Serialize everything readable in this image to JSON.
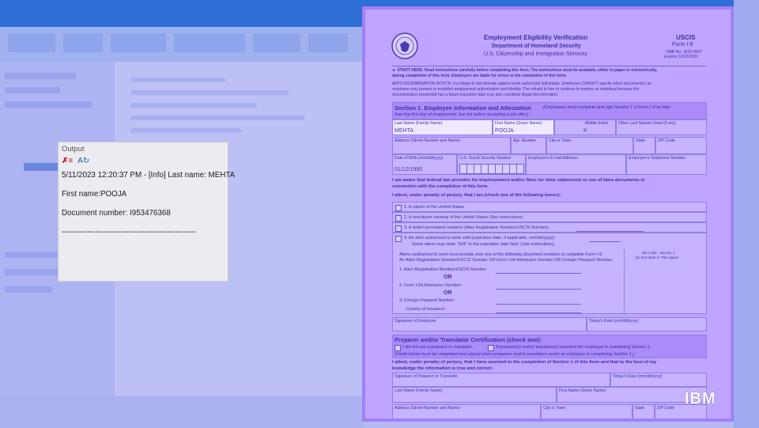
{
  "output_panel": {
    "title": "Output",
    "icons": [
      "clear-output-icon",
      "word-wrap-icon"
    ],
    "lines": [
      "5/11/2023 12:20:37 PM - [Info] Last name: MEHTA",
      "First name:POOJA",
      "Document number: I953476368",
      "----------------------------------------------------"
    ]
  },
  "form": {
    "title": "Employment Eligibility Verification",
    "department": "Department of Homeland Security",
    "agency": "U.S. Citizenship and Immigration Services",
    "uscis": "USCIS",
    "form_no": "Form I-9",
    "omb": "OMB No. 1615-0047",
    "expires": "Expires 10/31/2022",
    "start_here_1": "► START HERE: Read instructions carefully before completing this form. The instructions must be available, either in paper or electronically,",
    "start_here_2": "during completion of this form. Employers are liable for errors in the completion of this form.",
    "anti_1": "ANTI-DISCRIMINATION NOTICE: It is illegal to discriminate against work-authorized individuals. Employers CANNOT specify which document(s) an",
    "anti_2": "employee may present to establish employment authorization and identity. The refusal to hire or continue to employ an individual because the",
    "anti_3": "documentation presented has a future expiration date may also constitute illegal discrimination.",
    "section1_title": "Section 1. Employee Information and Attestation",
    "section1_sub_1": "(Employees must complete and sign Section 1 of Form I-9 no later",
    "section1_sub_2": "than the first day of employment, but not before accepting a job offer.)",
    "last_name_label": "Last Name (Family Name)",
    "last_name_value": "MEHTA",
    "first_name_label": "First Name (Given Name)",
    "first_name_value": "POOJA",
    "middle_initial_label": "Middle Initial",
    "middle_initial_value": "K",
    "other_last_names_label": "Other Last Names Used (if any)",
    "address_label": "Address (Street Number and Name)",
    "apt_label": "Apt. Number",
    "city_label": "City or Town",
    "state_label": "State",
    "zip_label": "ZIP Code",
    "dob_label": "Date of Birth (mm/dd/yyyy)",
    "dob_value": "01/12/1990",
    "ssn_label": "U.S. Social Security Number",
    "email_label": "Employee's E-mail Address",
    "phone_label": "Employee's Telephone Number",
    "aware_1": "I am aware that federal law provides for imprisonment and/or fines for false statements or use of false documents in",
    "aware_2": "connection with the completion of this form.",
    "attest": "I attest, under penalty of perjury, that I am (check one of the following boxes):",
    "opt1": "1. A citizen of the United States",
    "opt2": "2. A noncitizen national of the United States (See instructions)",
    "opt3": "3. A lawful permanent resident       (Alien Registration Number/USCIS Number):",
    "opt4": "4. An alien authorized to work   until (expiration date, if applicable, mm/dd/yyyy):",
    "opt4_sub": "Some aliens may write \"N/A\" in the expiration date field. (See instructions)",
    "aliens_1": "Aliens authorized to work must provide only one of the following document numbers to complete Form I-9:",
    "aliens_2": "An Alien Registration Number/USCIS Number OR Form I-94 Admission Number OR Foreign Passport Number.",
    "doc1": "1. Alien Registration Number/USCIS Number:",
    "or_1": "OR",
    "doc2": "2. Form I-94 Admission Number:",
    "or_2": "OR",
    "doc3": "3. Foreign Passport Number:",
    "country": "Country of Issuance:",
    "qr_1": "QR Code - Section 1",
    "qr_2": "Do Not Write In This Space",
    "sig_employee": "Signature of Employee",
    "todays_date": "Today's Date (mm/dd/yyyy)",
    "prep_title": "Preparer and/or Translator Certification (check one):",
    "prep_opt1": "I did not use a preparer or translator.",
    "prep_opt2": "A preparer(s) and/or translator(s) assisted the employee in completing Section 1.",
    "prep_sub": "(Fields below must be completed and signed when preparers and/or translators assist an employee in completing Section 1.)",
    "prep_attest_1": "I attest, under penalty of perjury, that I have assisted in the completion of Section 1 of this form and that to the best of my",
    "prep_attest_2": "knowledge the information is true and correct.",
    "sig_preparer": "Signature of Preparer or Translator",
    "todays_date_2": "Today's Date (mm/dd/yyyy)",
    "prep_last": "Last Name (Family Name)",
    "prep_first": "First Name (Given Name)",
    "prep_address": "Address (Street Number and Name)",
    "prep_city": "City or Town",
    "prep_state": "State",
    "prep_zip": "ZIP Code"
  },
  "watermark": "IBM"
}
